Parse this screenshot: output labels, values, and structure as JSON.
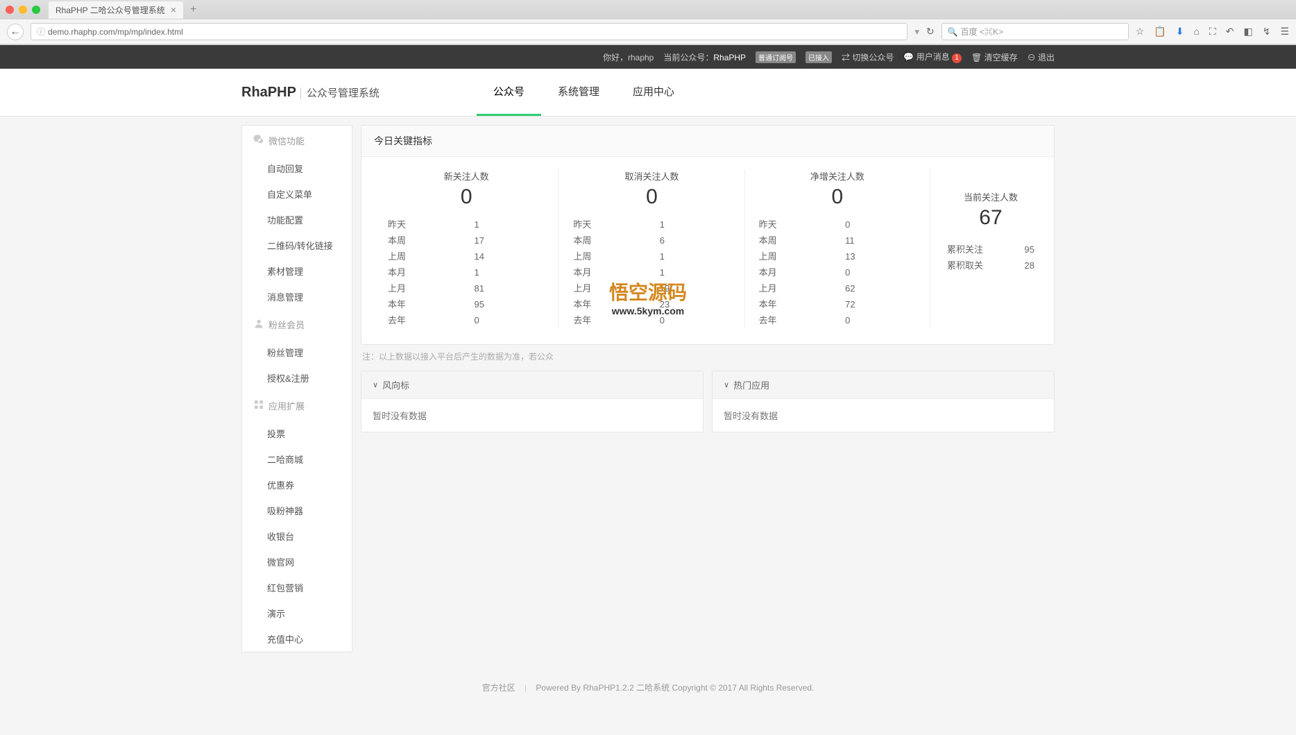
{
  "browser": {
    "tab_title": "RhaPHP 二哈公众号管理系统",
    "url": "demo.rhaphp.com/mp/mp/index.html",
    "search_placeholder": "百度 <⌘K>"
  },
  "topbar": {
    "greeting_prefix": "你好，",
    "username": "rhaphp",
    "current_account_label": "当前公众号：",
    "current_account_name": "RhaPHP",
    "account_type": "普通订阅号",
    "connected": "已接入",
    "switch_account": "切换公众号",
    "user_messages": "用户消息",
    "message_count": "1",
    "clear_cache": "清空缓存",
    "logout": "退出"
  },
  "header": {
    "logo_main": "RhaPHP",
    "logo_sub": "公众号管理系统",
    "nav": [
      "公众号",
      "系统管理",
      "应用中心"
    ],
    "active_index": 0
  },
  "sidebar": {
    "groups": [
      {
        "title": "微信功能",
        "icon": "wechat",
        "items": [
          "自动回复",
          "自定义菜单",
          "功能配置",
          "二维码/转化链接",
          "素材管理",
          "消息管理"
        ]
      },
      {
        "title": "粉丝会员",
        "icon": "user",
        "items": [
          "粉丝管理",
          "授权&注册"
        ]
      },
      {
        "title": "应用扩展",
        "icon": "apps",
        "items": [
          "投票",
          "二哈商城",
          "优惠券",
          "吸粉神器",
          "收银台",
          "微官网",
          "红包营销",
          "演示",
          "充值中心"
        ]
      }
    ]
  },
  "dashboard": {
    "title": "今日关键指标",
    "metrics": [
      {
        "label": "新关注人数",
        "value": "0",
        "rows": [
          [
            "昨天",
            "1"
          ],
          [
            "本周",
            "17"
          ],
          [
            "上周",
            "14"
          ],
          [
            "本月",
            "1"
          ],
          [
            "上月",
            "81"
          ],
          [
            "本年",
            "95"
          ],
          [
            "去年",
            "0"
          ]
        ]
      },
      {
        "label": "取消关注人数",
        "value": "0",
        "rows": [
          [
            "昨天",
            "1"
          ],
          [
            "本周",
            "6"
          ],
          [
            "上周",
            "1"
          ],
          [
            "本月",
            "1"
          ],
          [
            "上月",
            "19"
          ],
          [
            "本年",
            "23"
          ],
          [
            "去年",
            "0"
          ]
        ]
      },
      {
        "label": "净增关注人数",
        "value": "0",
        "rows": [
          [
            "昨天",
            "0"
          ],
          [
            "本周",
            "11"
          ],
          [
            "上周",
            "13"
          ],
          [
            "本月",
            "0"
          ],
          [
            "上月",
            "62"
          ],
          [
            "本年",
            "72"
          ],
          [
            "去年",
            "0"
          ]
        ]
      }
    ],
    "summary": {
      "label": "当前关注人数",
      "value": "67",
      "rows": [
        [
          "累积关注",
          "95"
        ],
        [
          "累积取关",
          "28"
        ]
      ]
    },
    "footnote": "注：以上数据以接入平台后产生的数据为准，若公众",
    "sections": [
      {
        "title": "风向标",
        "body": "暂时没有数据"
      },
      {
        "title": "热门应用",
        "body": "暂时没有数据"
      }
    ]
  },
  "footer": {
    "left": "官方社区",
    "right": "Powered By RhaPHP1.2.2 二哈系统 Copyright © 2017 All Rights Reserved."
  },
  "watermark": {
    "title": "悟空源码",
    "url": "www.5kym.com"
  }
}
